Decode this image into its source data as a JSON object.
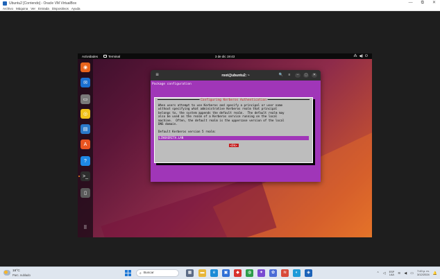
{
  "vbox": {
    "title": "Ubuntu2 [Corriendo] - Oracle VM VirtualBox",
    "window_controls": [
      "—",
      "⧉",
      "✕"
    ],
    "menu": [
      "Archivo",
      "Máquina",
      "Ver",
      "Entrada",
      "Dispositivos",
      "Ayuda"
    ]
  },
  "ubuntu": {
    "topbar": {
      "activities": "Actividades",
      "app_label": "Terminal",
      "clock": "3 de dic 19:43",
      "sys_icons": [
        "⁂",
        "◀)",
        "⏻"
      ]
    },
    "dock_items": [
      {
        "name": "firefox",
        "glyph": "◉",
        "color": "#e8641c"
      },
      {
        "name": "thunderbird",
        "glyph": "✉",
        "color": "#1a6fd1"
      },
      {
        "name": "files",
        "glyph": "▭",
        "color": "#7a7a7a"
      },
      {
        "name": "rhythmbox",
        "glyph": "◎",
        "color": "#f2c21b"
      },
      {
        "name": "libreoffice-writer",
        "glyph": "▤",
        "color": "#2a79c9"
      },
      {
        "name": "app-center",
        "glyph": "A",
        "color": "#e95420"
      },
      {
        "name": "help",
        "glyph": "?",
        "color": "#1e88e5"
      },
      {
        "name": "terminal",
        "glyph": ">_",
        "color": "#2d2d2d"
      },
      {
        "name": "trash",
        "glyph": "▯",
        "color": "#5a5a5a"
      },
      {
        "name": "show-apps",
        "glyph": "⠿",
        "color": "transparent"
      }
    ],
    "terminal": {
      "title": "root@ubuntu2: ~",
      "header_buttons": [
        "🔍",
        "≡",
        "–",
        "▢",
        "✕"
      ],
      "package_config": "Package configuration",
      "dialog": {
        "title": "Configuring Kerberos Authentication",
        "body": "When users attempt to use Kerberos and specify a principal or user name\nwithout specifying what administrative Kerberos realm that principal\nbelongs to, the system appends the default realm.  The default realm may\nalso be used as the realm of a Kerberos service running on the local\nmachine.  Often, the default realm is the uppercase version of the local\nDNS domain.",
        "prompt": "Default Kerberos version 5 realm:",
        "input_value": "LINUXERITA.LAN",
        "ok_label": "<Ok>"
      }
    }
  },
  "taskbar": {
    "weather_temp": "16°C",
    "weather_cond": "Parc. nublado",
    "search_placeholder": "Buscar",
    "apps": [
      {
        "name": "task-view",
        "glyph": "▦",
        "color": "#5b6b86"
      },
      {
        "name": "file-explorer",
        "glyph": "▬",
        "color": "#e8b73a"
      },
      {
        "name": "edge",
        "glyph": "e",
        "color": "#1b8bd6"
      },
      {
        "name": "store",
        "glyph": "▣",
        "color": "#2f6fd6"
      },
      {
        "name": "app-red",
        "glyph": "◆",
        "color": "#d8322d"
      },
      {
        "name": "chrome",
        "glyph": "◍",
        "color": "#2c9c4a"
      },
      {
        "name": "app-a",
        "glyph": "✦",
        "color": "#7a4bd1"
      },
      {
        "name": "app-b",
        "glyph": "✿",
        "color": "#4a6bd6"
      },
      {
        "name": "app-c",
        "glyph": "≋",
        "color": "#d84a3a"
      },
      {
        "name": "app-d",
        "glyph": "◐",
        "color": "#1f9bd8"
      },
      {
        "name": "virtualbox",
        "glyph": "◈",
        "color": "#1d63b8"
      }
    ],
    "lang_top": "ESP",
    "lang_bottom": "LAA",
    "time": "7:43 p. m.",
    "date": "3/12/2024"
  }
}
